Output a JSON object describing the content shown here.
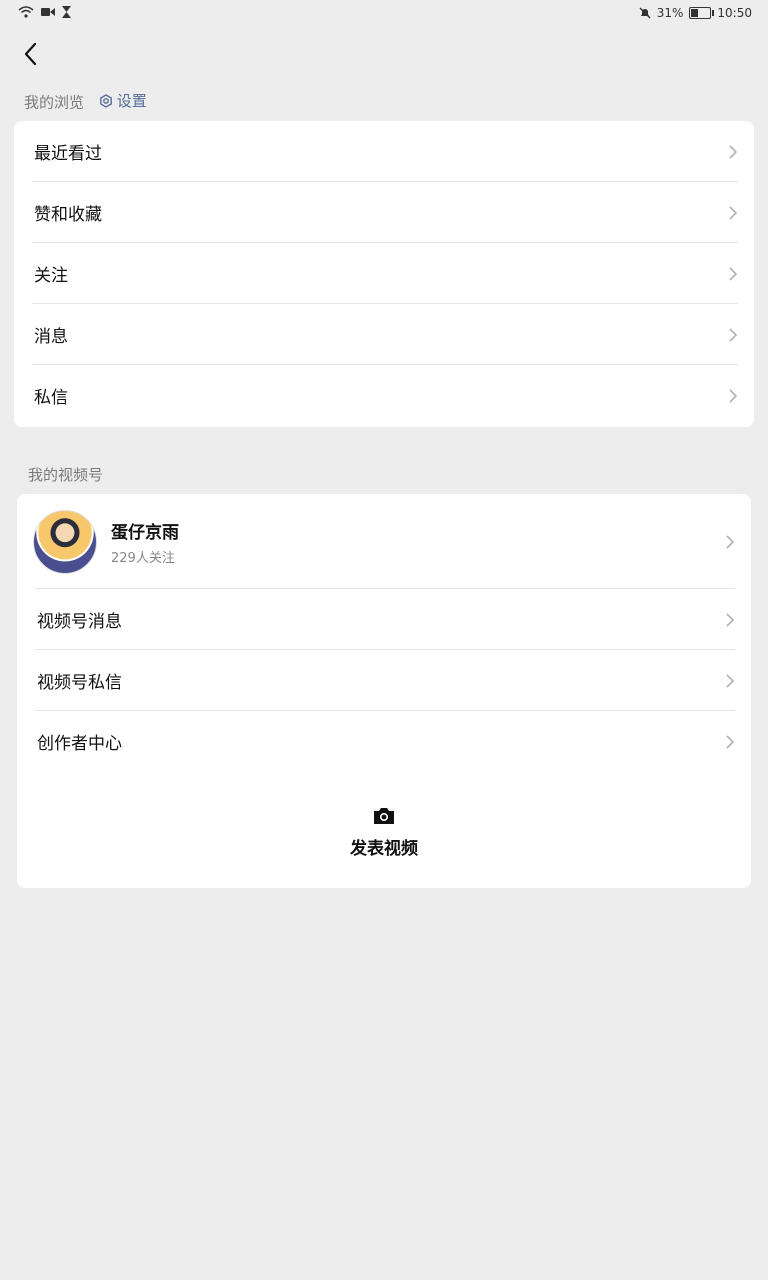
{
  "status": {
    "battery_percent": "31%",
    "battery_level": 0.31,
    "time": "10:50",
    "icons": [
      "wifi-icon",
      "video-icon",
      "hourglass-icon",
      "mute-icon",
      "battery-icon"
    ]
  },
  "nav": {
    "back_icon": "chevron-left-icon"
  },
  "browse": {
    "title": "我的浏览",
    "settings_label": "设置",
    "items": [
      {
        "label": "最近看过"
      },
      {
        "label": "赞和收藏"
      },
      {
        "label": "关注"
      },
      {
        "label": "消息"
      },
      {
        "label": "私信"
      }
    ]
  },
  "channel": {
    "title": "我的视频号",
    "profile": {
      "name": "蛋仔京雨",
      "followers": "229人关注"
    },
    "items": [
      {
        "label": "视频号消息"
      },
      {
        "label": "视频号私信"
      },
      {
        "label": "创作者中心"
      }
    ],
    "publish_label": "发表视频",
    "publish_icon": "camera-icon"
  },
  "colors": {
    "background": "#ededed",
    "link": "#576b95",
    "card": "#ffffff"
  }
}
